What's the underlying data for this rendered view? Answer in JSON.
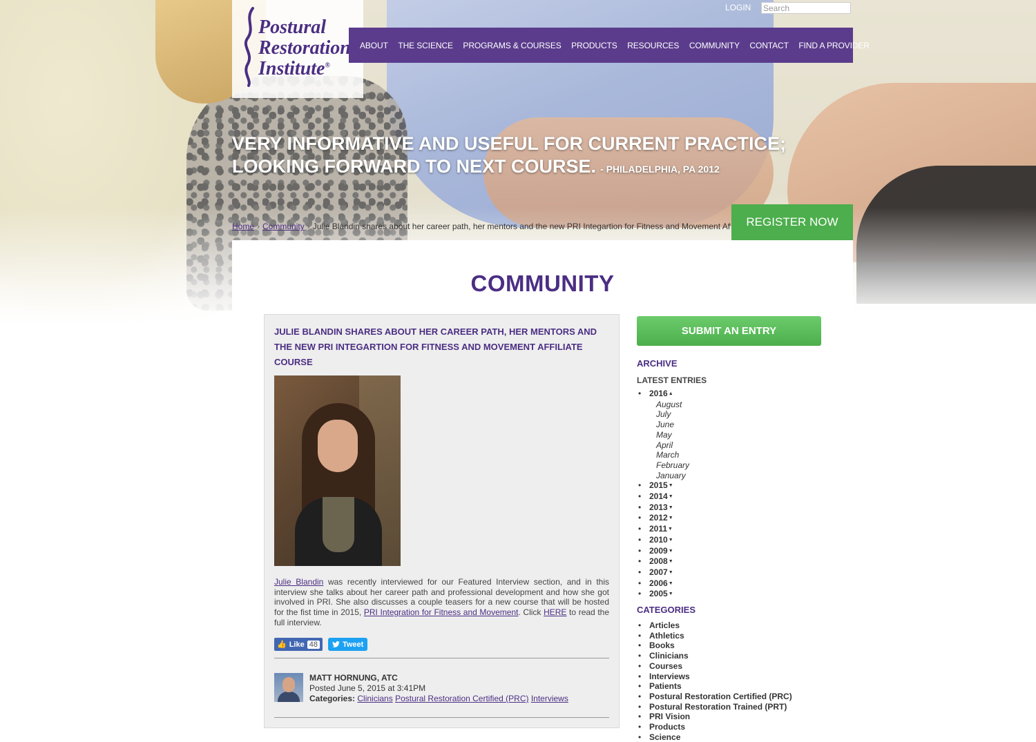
{
  "logo": {
    "line1": "Postural",
    "line2": "Restoration",
    "line3": "Institute",
    "reg": "®"
  },
  "utility": {
    "login": "LOGIN",
    "search_placeholder": "Search"
  },
  "nav": [
    "ABOUT",
    "THE SCIENCE",
    "PROGRAMS & COURSES",
    "PRODUCTS",
    "RESOURCES",
    "COMMUNITY",
    "CONTACT",
    "FIND A PROVIDER"
  ],
  "quote": {
    "text": "VERY INFORMATIVE AND USEFUL FOR CURRENT PRACTICE; LOOKING FORWARD TO NEXT COURSE.",
    "source": "- PHILADELPHIA, PA 2012"
  },
  "breadcrumb": {
    "home": "Home",
    "community": "Community",
    "sep": "›",
    "current": "Julie Blandin shares about her career path, her mentors and the new PRI Integartion for Fitness and Movement Affiliate Course"
  },
  "register": "REGISTER NOW",
  "page_title": "COMMUNITY",
  "article": {
    "title": "JULIE BLANDIN SHARES ABOUT HER CAREER PATH, HER MENTORS AND THE NEW PRI INTEGARTION FOR FITNESS AND MOVEMENT AFFILIATE COURSE",
    "body_link1": "Julie Blandin",
    "body_part1": " was recently interviewed for our Featured Interview section, and in this interview she talks about her career path and professional development and how she got involved in PRI. She also discusses a couple teasers for a new course that will be hosted for the fist time in 2015, ",
    "body_link2": "PRI Integration for Fitness and Movement",
    "body_part2": ". Click ",
    "body_link3": "HERE",
    "body_part3": " to read the full interview.",
    "like_label": "Like",
    "like_count": "48",
    "tweet_label": "Tweet",
    "author_name": "MATT HORNUNG, ATC",
    "posted": "Posted June 5, 2015 at 3:41PM",
    "categories_label": "Categories:",
    "categories": [
      "Clinicians",
      "Postural Restoration Certified (PRC)",
      "Interviews"
    ]
  },
  "sidebar": {
    "submit": "SUBMIT AN ENTRY",
    "archive_heading": "ARCHIVE",
    "latest_heading": "LATEST ENTRIES",
    "current_year": "2016",
    "months": [
      "August",
      "July",
      "June",
      "May",
      "April",
      "March",
      "February",
      "January"
    ],
    "years": [
      "2015",
      "2014",
      "2013",
      "2012",
      "2011",
      "2010",
      "2009",
      "2008",
      "2007",
      "2006",
      "2005"
    ],
    "categories_heading": "CATEGORIES",
    "categories": [
      "Articles",
      "Athletics",
      "Books",
      "Clinicians",
      "Courses",
      "Interviews",
      "Patients",
      "Postural Restoration Certified (PRC)",
      "Postural Restoration Trained (PRT)",
      "PRI Vision",
      "Products",
      "Science"
    ]
  },
  "colors": {
    "brand_purple": "#5b3c8c",
    "heading_purple": "#4b2e83",
    "register_green": "#4cae4c"
  }
}
